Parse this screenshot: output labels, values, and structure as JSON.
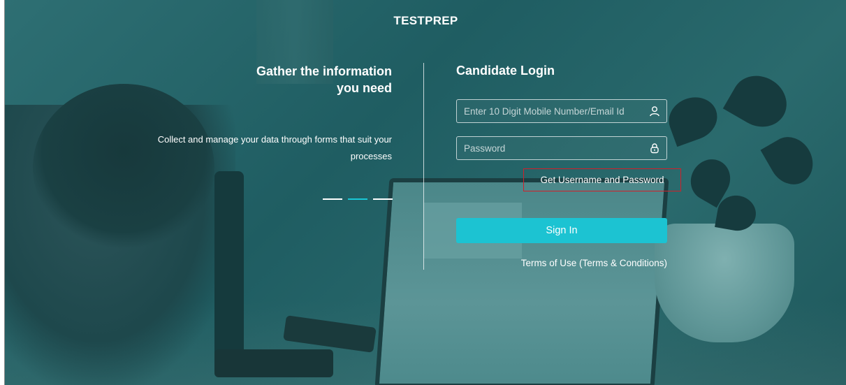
{
  "header": {
    "title": "TESTPREP"
  },
  "promo": {
    "heading": "Gather the information you need",
    "subtext": "Collect and manage your data through forms that suit your processes",
    "carousel": {
      "slides": 3,
      "active_index": 1
    }
  },
  "login": {
    "title": "Candidate Login",
    "username": {
      "placeholder": "Enter 10 Digit Mobile Number/Email Id",
      "value": "",
      "icon": "user-icon"
    },
    "password": {
      "placeholder": "Password",
      "value": "",
      "icon": "lock-icon"
    },
    "get_credentials_label": "Get Username and Password",
    "signin_label": "Sign In",
    "terms_label": "Terms of Use (Terms & Conditions)"
  },
  "colors": {
    "accent": "#1cc3d2",
    "background": "#235f63",
    "highlight_border": "#d0202a"
  }
}
